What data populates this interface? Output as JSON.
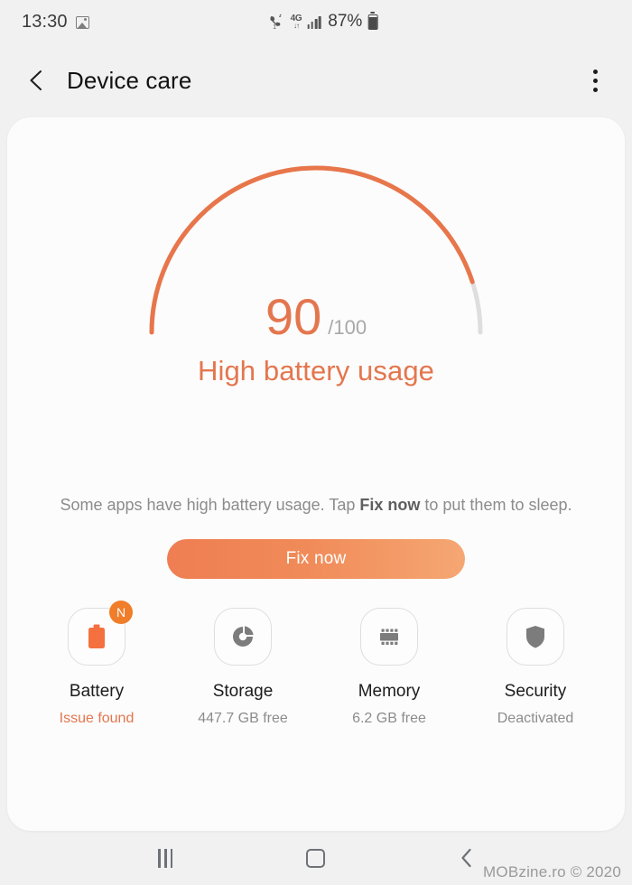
{
  "status_bar": {
    "clock": "13:30",
    "image_icon": "image-icon",
    "call_icon": "call-wifi-icon",
    "network_label": "4G",
    "network_arrows": "↓↑",
    "signal_icon": "signal-bars-icon",
    "battery_percent": "87%",
    "battery_icon": "battery-icon"
  },
  "app_bar": {
    "back_icon": "back-arrow-icon",
    "title": "Device care",
    "menu_icon": "more-options-icon"
  },
  "gauge": {
    "score": "90",
    "denominator": "/100",
    "status_text": "High battery usage",
    "max": 100,
    "value": 90,
    "track_color": "#dedede",
    "fill_color": "#e8764b"
  },
  "description": {
    "part1": "Some apps have high battery usage. Tap ",
    "emphasis": "Fix now",
    "part2": " to put them to sleep."
  },
  "action": {
    "fix_now_label": "Fix now",
    "gradient_from": "#ef7e53",
    "gradient_to": "#f5a773"
  },
  "tiles": [
    {
      "icon": "battery-icon",
      "label": "Battery",
      "status": "Issue found",
      "status_warn": true,
      "badge": "N"
    },
    {
      "icon": "storage-pie-icon",
      "label": "Storage",
      "status": "447.7 GB free",
      "status_warn": false,
      "badge": null
    },
    {
      "icon": "memory-chip-icon",
      "label": "Memory",
      "status": "6.2 GB free",
      "status_warn": false,
      "badge": null
    },
    {
      "icon": "shield-icon",
      "label": "Security",
      "status": "Deactivated",
      "status_warn": false,
      "badge": null
    }
  ],
  "nav_bar": {
    "recents_icon": "recents-icon",
    "home_icon": "home-icon",
    "back_icon": "back-icon"
  },
  "watermark": "MOBzine.ro © 2020"
}
